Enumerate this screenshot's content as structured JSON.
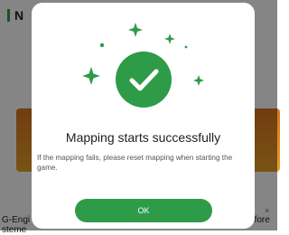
{
  "background": {
    "header_title": "N",
    "bottom_left_text": "G-Engi\nsteme",
    "bottom_right_text": "efore",
    "close_glyph": "×"
  },
  "dialog": {
    "title": "Mapping starts successfully",
    "message": "If the mapping fails, please reset mapping when starting the game.",
    "ok_label": "OK"
  },
  "colors": {
    "accent": "#2e9b48",
    "overlay": "rgba(0,0,0,0.48)",
    "card_orange": "#e08a24"
  },
  "icons": [
    "check-circle-icon",
    "sparkle-icon",
    "dot-icon",
    "close-icon"
  ]
}
